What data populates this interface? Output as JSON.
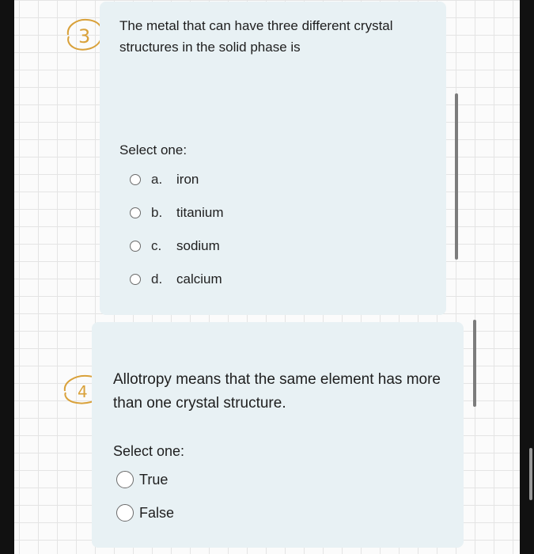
{
  "questions": [
    {
      "number_annotation": "3",
      "text": "The metal that can have three different crystal structures in the solid phase is",
      "select_label": "Select one:",
      "options": [
        {
          "letter": "a.",
          "text": "iron"
        },
        {
          "letter": "b.",
          "text": "titanium"
        },
        {
          "letter": "c.",
          "text": "sodium"
        },
        {
          "letter": "d.",
          "text": "calcium"
        }
      ]
    },
    {
      "number_annotation": "4",
      "text": "Allotropy means that the same element has more than one crystal structure.",
      "select_label": "Select one:",
      "options": [
        {
          "text": "True"
        },
        {
          "text": "False"
        }
      ]
    }
  ],
  "colors": {
    "card_background": "#e8f1f4",
    "handwriting": "#d9a13a",
    "radio_border": "#6b6b6b"
  },
  "icons": [
    "radio-unchecked-icon",
    "handwritten-circled-number"
  ]
}
